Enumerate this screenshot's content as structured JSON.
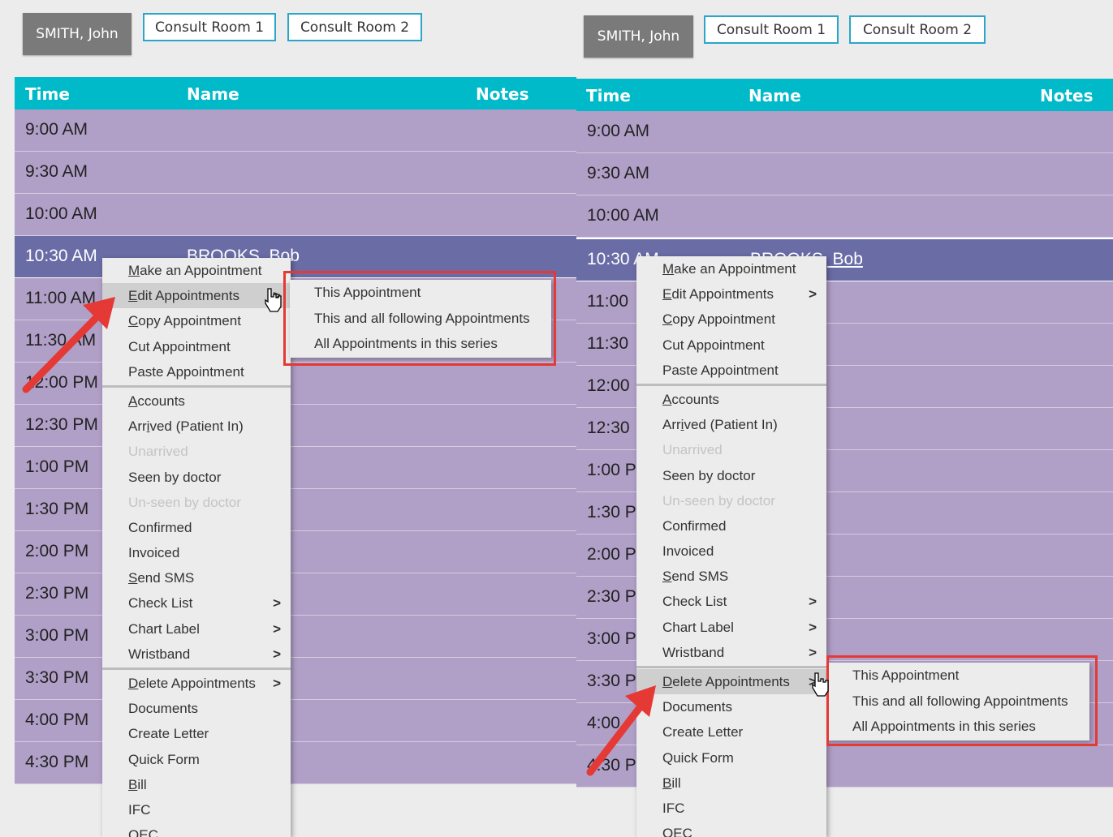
{
  "header": {
    "doctor": "SMITH, John",
    "rooms": [
      "Consult Room 1",
      "Consult Room 2"
    ]
  },
  "columns": {
    "time": "Time",
    "name": "Name",
    "notes": "Notes"
  },
  "left": {
    "rows": [
      {
        "time": "9:00 AM",
        "name": ""
      },
      {
        "time": "9:30 AM",
        "name": ""
      },
      {
        "time": "10:00 AM",
        "name": ""
      },
      {
        "time": "10:30 AM",
        "name": "BROOKS, Bob"
      },
      {
        "time": "11:00 AM",
        "name": ""
      },
      {
        "time": "11:30 AM",
        "name": ""
      },
      {
        "time": "12:00 PM",
        "name": ""
      },
      {
        "time": "12:30 PM",
        "name": ""
      },
      {
        "time": "1:00 PM",
        "name": ""
      },
      {
        "time": "1:30 PM",
        "name": ""
      },
      {
        "time": "2:00 PM",
        "name": ""
      },
      {
        "time": "2:30 PM",
        "name": ""
      },
      {
        "time": "3:00 PM",
        "name": ""
      },
      {
        "time": "3:30 PM",
        "name": ""
      },
      {
        "time": "4:00 PM",
        "name": ""
      },
      {
        "time": "4:30 PM",
        "name": ""
      }
    ],
    "submenu": [
      "This Appointment",
      "This and all following Appointments",
      "All Appointments in this series"
    ]
  },
  "right": {
    "rows": [
      {
        "time": "9:00 AM",
        "name": ""
      },
      {
        "time": "9:30 AM",
        "name": ""
      },
      {
        "time": "10:00 AM",
        "name": ""
      },
      {
        "time": "10:30 AM",
        "name": "BROOKS, Bob"
      },
      {
        "time": "11:00",
        "name": ""
      },
      {
        "time": "11:30",
        "name": ""
      },
      {
        "time": "12:00",
        "name": ""
      },
      {
        "time": "12:30",
        "name": ""
      },
      {
        "time": "1:00 P",
        "name": ""
      },
      {
        "time": "1:30 P",
        "name": ""
      },
      {
        "time": "2:00 P",
        "name": ""
      },
      {
        "time": "2:30 P",
        "name": ""
      },
      {
        "time": "3:00 P",
        "name": ""
      },
      {
        "time": "3:30 P",
        "name": ""
      },
      {
        "time": "4:00",
        "name": ""
      },
      {
        "time": "4:30 P",
        "name": ""
      }
    ],
    "submenu": [
      "This Appointment",
      "This and all following Appointments",
      "All Appointments in this series"
    ]
  },
  "context_menu": [
    {
      "pre": "",
      "u": "M",
      "post": "ake an Appointment",
      "arrow": "",
      "disabled": false
    },
    {
      "pre": "",
      "u": "E",
      "post": "dit Appointments",
      "arrow": ">",
      "disabled": false
    },
    {
      "pre": "",
      "u": "C",
      "post": "opy Appointment",
      "arrow": "",
      "disabled": false
    },
    {
      "pre": "Cut Appointment",
      "u": "",
      "post": "",
      "arrow": "",
      "disabled": false
    },
    {
      "pre": "Paste Appointment",
      "u": "",
      "post": "",
      "arrow": "",
      "disabled": false,
      "sep_after": true
    },
    {
      "pre": "",
      "u": "A",
      "post": "ccounts",
      "arrow": "",
      "disabled": false
    },
    {
      "pre": "Arr",
      "u": "i",
      "post": "ved (Patient In)",
      "arrow": "",
      "disabled": false
    },
    {
      "pre": "Unarrived",
      "u": "",
      "post": "",
      "arrow": "",
      "disabled": true
    },
    {
      "pre": "Seen by doctor",
      "u": "",
      "post": "",
      "arrow": "",
      "disabled": false
    },
    {
      "pre": "Un-seen by doctor",
      "u": "",
      "post": "",
      "arrow": "",
      "disabled": true
    },
    {
      "pre": "Confirmed",
      "u": "",
      "post": "",
      "arrow": "",
      "disabled": false
    },
    {
      "pre": "Invoiced",
      "u": "",
      "post": "",
      "arrow": "",
      "disabled": false
    },
    {
      "pre": "",
      "u": "S",
      "post": "end SMS",
      "arrow": "",
      "disabled": false
    },
    {
      "pre": "Check List",
      "u": "",
      "post": "",
      "arrow": ">",
      "disabled": false
    },
    {
      "pre": "Chart Label",
      "u": "",
      "post": "",
      "arrow": ">",
      "disabled": false
    },
    {
      "pre": "Wristband",
      "u": "",
      "post": "",
      "arrow": ">",
      "disabled": false,
      "sep_after": true
    },
    {
      "pre": "",
      "u": "D",
      "post": "elete Appointments",
      "arrow": ">",
      "disabled": false
    },
    {
      "pre": "Documents",
      "u": "",
      "post": "",
      "arrow": "",
      "disabled": false
    },
    {
      "pre": "Create Letter",
      "u": "",
      "post": "",
      "arrow": "",
      "disabled": false
    },
    {
      "pre": "Quick Form",
      "u": "",
      "post": "",
      "arrow": "",
      "disabled": false
    },
    {
      "pre": "",
      "u": "B",
      "post": "ill",
      "arrow": "",
      "disabled": false
    },
    {
      "pre": "IFC",
      "u": "",
      "post": "",
      "arrow": "",
      "disabled": false
    },
    {
      "pre": "",
      "u": "O",
      "post": "EC",
      "arrow": "",
      "disabled": false
    }
  ],
  "colors": {
    "header_teal": "#00b9c9",
    "slot_purple": "#b09fc7",
    "selected_slot": "#6a6ca6",
    "callout_red": "#e53935"
  },
  "icons": {
    "cursor": "hand-pointer-icon",
    "callout": "red-arrow-icon"
  }
}
